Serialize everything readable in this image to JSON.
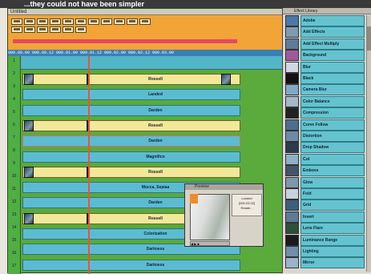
{
  "banner": "...they could not have been simpler",
  "editor": {
    "title": "Untitled",
    "ruler_text": "000.00.00     000.00.12     000.01.00     000.01.12     000.02.00     000.02.12     000.03.00"
  },
  "timeline": {
    "row_numbers": [
      "1",
      "2",
      "3",
      "4",
      "5",
      "6",
      "7",
      "8",
      "9",
      "10",
      "11",
      "12",
      "13",
      "14",
      "15",
      "16",
      "17"
    ],
    "tracks": [
      {
        "label": "Rossell",
        "style": "yellow",
        "split": true,
        "thumb": true
      },
      {
        "label": "Landed",
        "style": "cyan",
        "split": false,
        "thumb": false
      },
      {
        "label": "Darden",
        "style": "cyan",
        "split": false,
        "thumb": false
      },
      {
        "label": "Rossell",
        "style": "yellow",
        "split": true,
        "thumb": false
      },
      {
        "label": "Darden",
        "style": "pink",
        "split": false,
        "thumb": false
      },
      {
        "label": "Magnifico",
        "style": "cyan",
        "split": false,
        "thumb": false
      },
      {
        "label": "Rossell",
        "style": "yellow",
        "split": true,
        "thumb": false
      },
      {
        "label": "Mocca, Sepiaa",
        "style": "cyan",
        "split": false,
        "thumb": false
      },
      {
        "label": "Darden",
        "style": "cyan",
        "split": false,
        "thumb": false
      },
      {
        "label": "Rossell",
        "style": "yellow",
        "split": true,
        "thumb": true
      },
      {
        "label": "Colorization",
        "style": "cyan",
        "split": false,
        "thumb": false
      },
      {
        "label": "Darkness",
        "style": "cyan",
        "split": false,
        "thumb": false
      },
      {
        "label": "Darkness",
        "style": "cyan",
        "split": false,
        "thumb": false
      }
    ]
  },
  "preview": {
    "title": "Preview",
    "info_line1": "Landed",
    "info_line2": "[000.03.02]",
    "info_line3": "Rotate...",
    "controls": "◀ ▶ ■"
  },
  "library": {
    "title": "Effect Library",
    "items": [
      {
        "label": "Adobe",
        "icon": "#4a78a8"
      },
      {
        "label": "Add Effects",
        "icon": "#7f9bb4"
      },
      {
        "label": "Add Effect Multiply",
        "icon": "#5d7c9a"
      },
      {
        "label": "Background",
        "icon": "#9d5a9a"
      },
      {
        "label": "Blur",
        "icon": "#cfd7e0"
      },
      {
        "label": "Black",
        "icon": "#111111"
      },
      {
        "label": "Camera Blur",
        "icon": "#7faac7"
      },
      {
        "label": "Color Balance",
        "icon": "#a6b7c7"
      },
      {
        "label": "Compression",
        "icon": "#222222"
      },
      {
        "label": "Curve Follow",
        "icon": "#4c6f8f"
      },
      {
        "label": "Distortion",
        "icon": "#6d8aa6"
      },
      {
        "label": "Drop Shadow",
        "icon": "#2a3b4c"
      },
      {
        "label": "Cut",
        "icon": "#8fb0c6"
      },
      {
        "label": "Emboss",
        "icon": "#44546a"
      },
      {
        "label": "Glow",
        "icon": "#7f97ad"
      },
      {
        "label": "Fold",
        "icon": "#c8d2dc"
      },
      {
        "label": "Grid",
        "icon": "#3d5f7f"
      },
      {
        "label": "Invert",
        "icon": "#5e7a94"
      },
      {
        "label": "Lens Flare",
        "icon": "#2d4f3a"
      },
      {
        "label": "Luminance Range",
        "icon": "#1b1b1b"
      },
      {
        "label": "Lighting",
        "icon": "#6e8fac"
      },
      {
        "label": "Mirror",
        "icon": "#9ab4c9"
      }
    ]
  }
}
